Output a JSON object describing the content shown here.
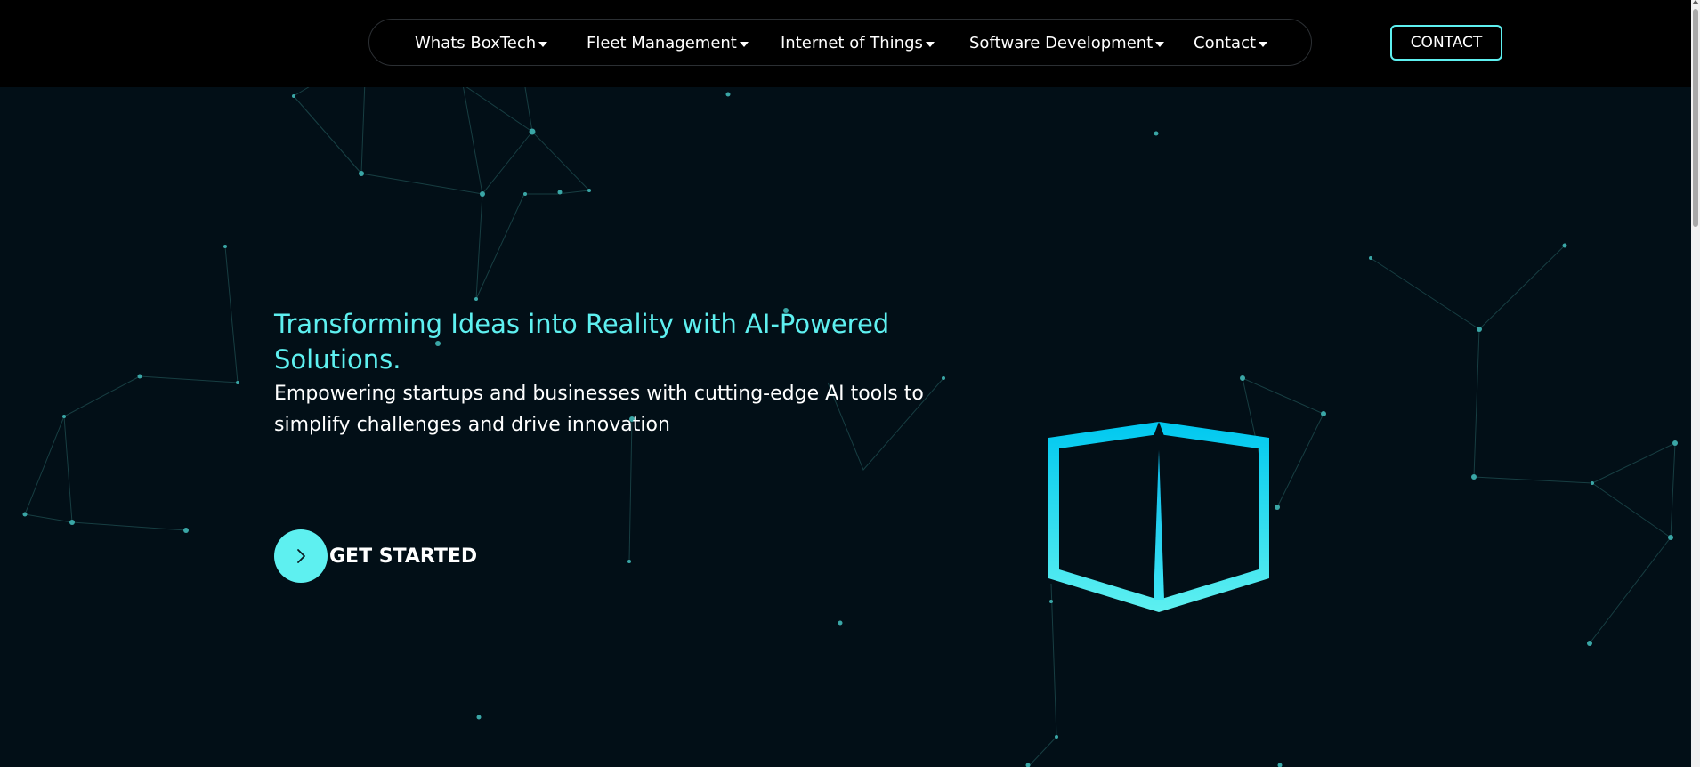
{
  "header": {
    "nav_items": [
      {
        "label": "Whats BoxTech"
      },
      {
        "label": "Fleet Management"
      },
      {
        "label": "Internet of Things"
      },
      {
        "label": "Software Development"
      },
      {
        "label": "Contact"
      }
    ],
    "contact_button": "CONTACT"
  },
  "hero": {
    "title": "Transforming Ideas into Reality with AI-Powered Solutions.",
    "subtitle": "Empowering startups and businesses with cutting-edge AI tools to simplify challenges and drive innovation",
    "cta_label": "GET STARTED",
    "cta_icon": "chevron-right-icon"
  },
  "colors": {
    "accent": "#5ef0f0",
    "background": "#020f17",
    "header_background": "#000000",
    "logo_gradient_top": "#00c8f0",
    "logo_gradient_bottom": "#5ef0f0"
  },
  "icons": {
    "logo": "boxtech-cube-logo-icon",
    "caret": "caret-down-icon"
  }
}
